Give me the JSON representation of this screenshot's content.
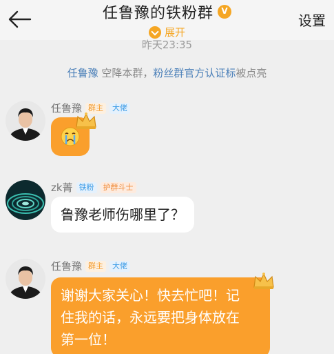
{
  "header": {
    "title": "任鲁豫的铁粉群",
    "expand_label": "展开",
    "settings_label": "设置"
  },
  "chat": {
    "timestamp": "昨天23:35",
    "system_message": {
      "name1": "任鲁豫",
      "text1": " 空降本群，",
      "name2": "粉丝群官方认证标",
      "text2": "被点亮"
    },
    "messages": [
      {
        "sender": "任鲁豫",
        "tags": [
          "群主",
          "大佬"
        ],
        "content": "",
        "emoji": "crying-face"
      },
      {
        "sender": "zk菁",
        "tags": [
          "铁粉",
          "护群斗士"
        ],
        "content": "鲁豫老师伤哪里了？"
      },
      {
        "sender": "任鲁豫",
        "tags": [
          "群主",
          "大佬"
        ],
        "lines": [
          "谢谢大家关心！快去忙吧！记",
          "住我的话，永远要把身体放在",
          "第一位！"
        ]
      }
    ]
  },
  "colors": {
    "accent": "#f5a623",
    "bubble_orange": "#fa9f2c",
    "link_blue": "#4a7fb8",
    "background": "#efefef"
  }
}
